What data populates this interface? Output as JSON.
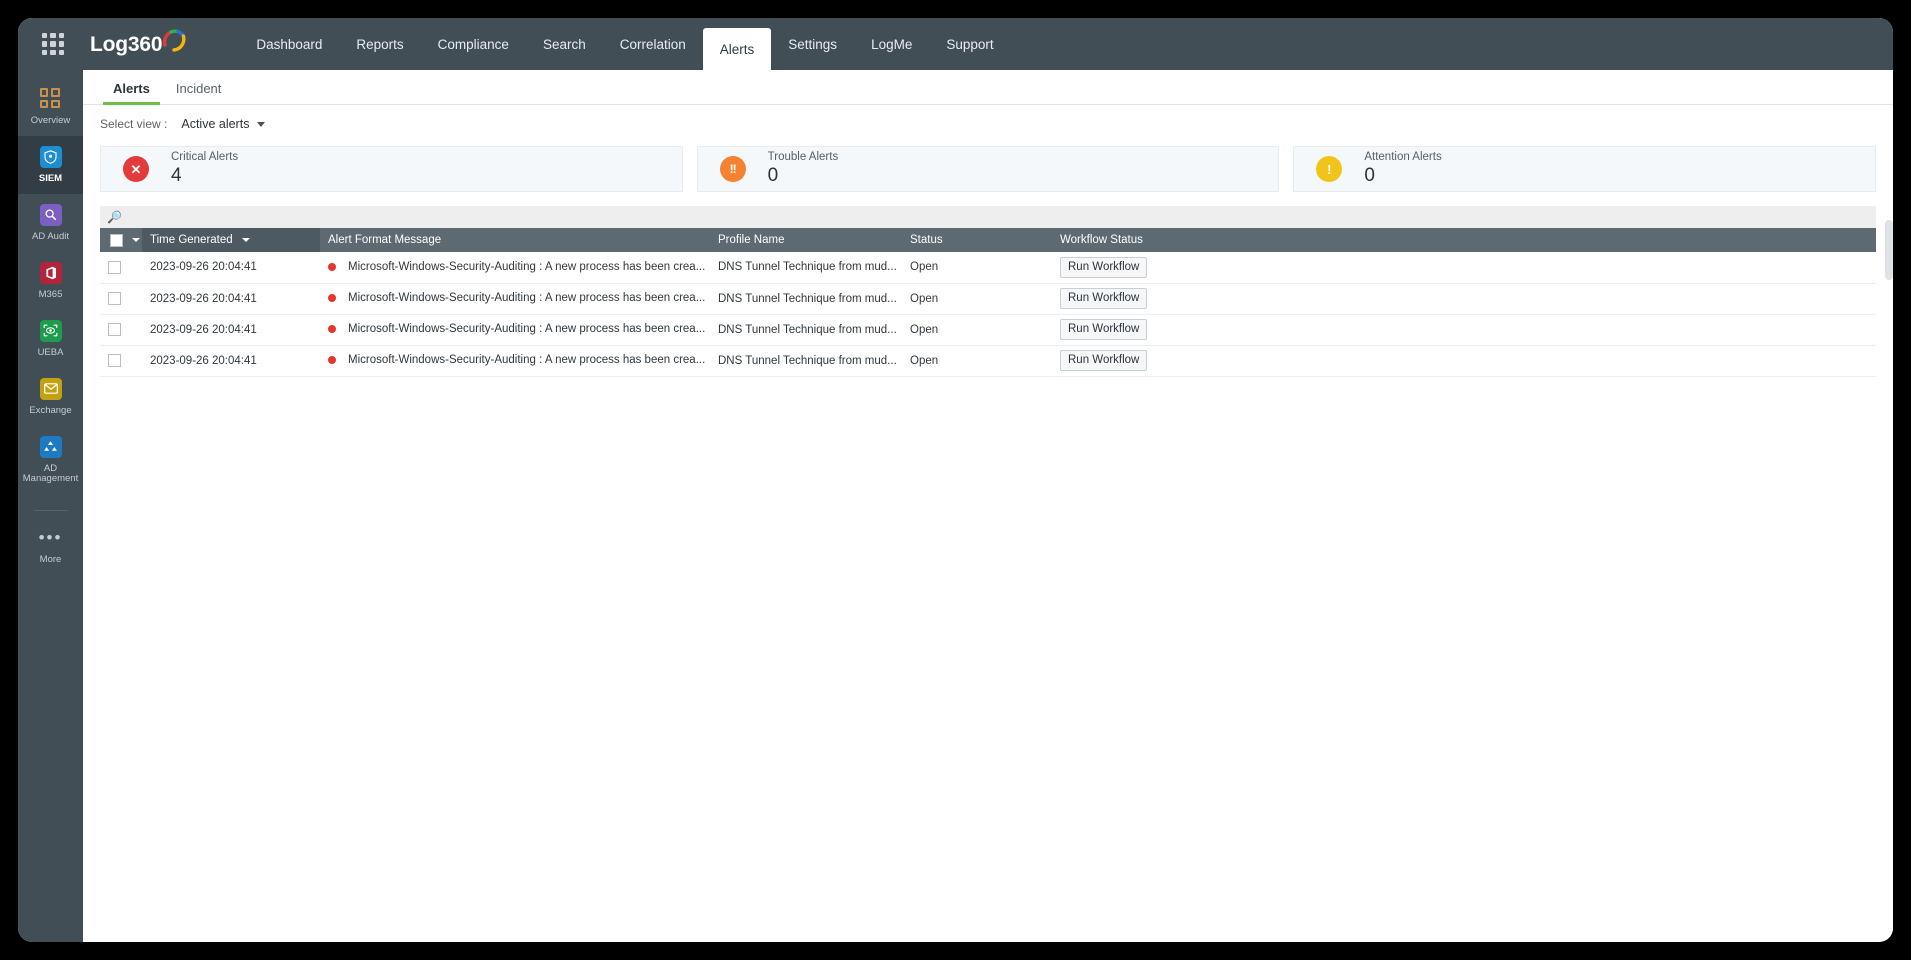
{
  "header": {
    "waffle_icon": "apps-grid-icon",
    "brand": "Log360",
    "nav": [
      {
        "label": "Dashboard",
        "active": false
      },
      {
        "label": "Reports",
        "active": false
      },
      {
        "label": "Compliance",
        "active": false
      },
      {
        "label": "Search",
        "active": false
      },
      {
        "label": "Correlation",
        "active": false
      },
      {
        "label": "Alerts",
        "active": true
      },
      {
        "label": "Settings",
        "active": false
      },
      {
        "label": "LogMe",
        "active": false
      },
      {
        "label": "Support",
        "active": false
      }
    ]
  },
  "sidebar": {
    "items": [
      {
        "label": "Overview",
        "icon": "overview-grid-icon",
        "active": false
      },
      {
        "label": "SIEM",
        "icon": "siem-shield-icon",
        "active": true
      },
      {
        "label": "AD Audit",
        "icon": "ad-audit-search-icon",
        "active": false
      },
      {
        "label": "M365",
        "icon": "m365-office-icon",
        "active": false
      },
      {
        "label": "UEBA",
        "icon": "ueba-eye-icon",
        "active": false
      },
      {
        "label": "Exchange",
        "icon": "exchange-mail-icon",
        "active": false
      },
      {
        "label": "AD Management",
        "icon": "ad-management-icon",
        "active": false
      }
    ],
    "more": {
      "label": "More",
      "icon": "ellipsis-icon"
    }
  },
  "tabs": [
    {
      "label": "Alerts",
      "active": true
    },
    {
      "label": "Incident",
      "active": false
    }
  ],
  "select_view": {
    "label": "Select view :",
    "value": "Active alerts",
    "caret_icon": "chevron-down-icon"
  },
  "summary_cards": [
    {
      "title": "Critical Alerts",
      "count": "4",
      "badge_glyph": "✕",
      "badge_icon": "critical-x-icon",
      "color": "#e33b3b"
    },
    {
      "title": "Trouble Alerts",
      "count": "0",
      "badge_glyph": "!!",
      "badge_icon": "trouble-bang-icon",
      "color": "#f58231"
    },
    {
      "title": "Attention Alerts",
      "count": "0",
      "badge_glyph": "!",
      "badge_icon": "attention-bang-icon",
      "color": "#f0c419"
    }
  ],
  "search": {
    "placeholder": "",
    "value": "",
    "icon": "search-icon"
  },
  "table": {
    "columns": [
      {
        "key": "check",
        "label": ""
      },
      {
        "key": "time",
        "label": "Time Generated",
        "sorted": true,
        "sort_icon": "sort-desc-icon"
      },
      {
        "key": "message",
        "label": "Alert Format Message"
      },
      {
        "key": "profile",
        "label": "Profile Name"
      },
      {
        "key": "status",
        "label": "Status"
      },
      {
        "key": "workflow",
        "label": "Workflow Status"
      }
    ],
    "rows": [
      {
        "time": "2023-09-26 20:04:41",
        "severity_color": "#e8352c",
        "message": "Microsoft-Windows-Security-Auditing : A new process has been crea...",
        "profile": "DNS Tunnel Technique from mud...",
        "status": "Open",
        "workflow_button": "Run Workflow"
      },
      {
        "time": "2023-09-26 20:04:41",
        "severity_color": "#e8352c",
        "message": "Microsoft-Windows-Security-Auditing : A new process has been crea...",
        "profile": "DNS Tunnel Technique from mud...",
        "status": "Open",
        "workflow_button": "Run Workflow"
      },
      {
        "time": "2023-09-26 20:04:41",
        "severity_color": "#e8352c",
        "message": "Microsoft-Windows-Security-Auditing : A new process has been crea...",
        "profile": "DNS Tunnel Technique from mud...",
        "status": "Open",
        "workflow_button": "Run Workflow"
      },
      {
        "time": "2023-09-26 20:04:41",
        "severity_color": "#e8352c",
        "message": "Microsoft-Windows-Security-Auditing : A new process has been crea...",
        "profile": "DNS Tunnel Technique from mud...",
        "status": "Open",
        "workflow_button": "Run Workflow"
      }
    ]
  },
  "colors": {
    "header_bg": "#414e56",
    "rail_bg": "#414e56",
    "rail_active": "#323d45",
    "tab_underline": "#6cbf45",
    "table_header": "#5d6a72",
    "card_bg": "#f4f8fa"
  }
}
